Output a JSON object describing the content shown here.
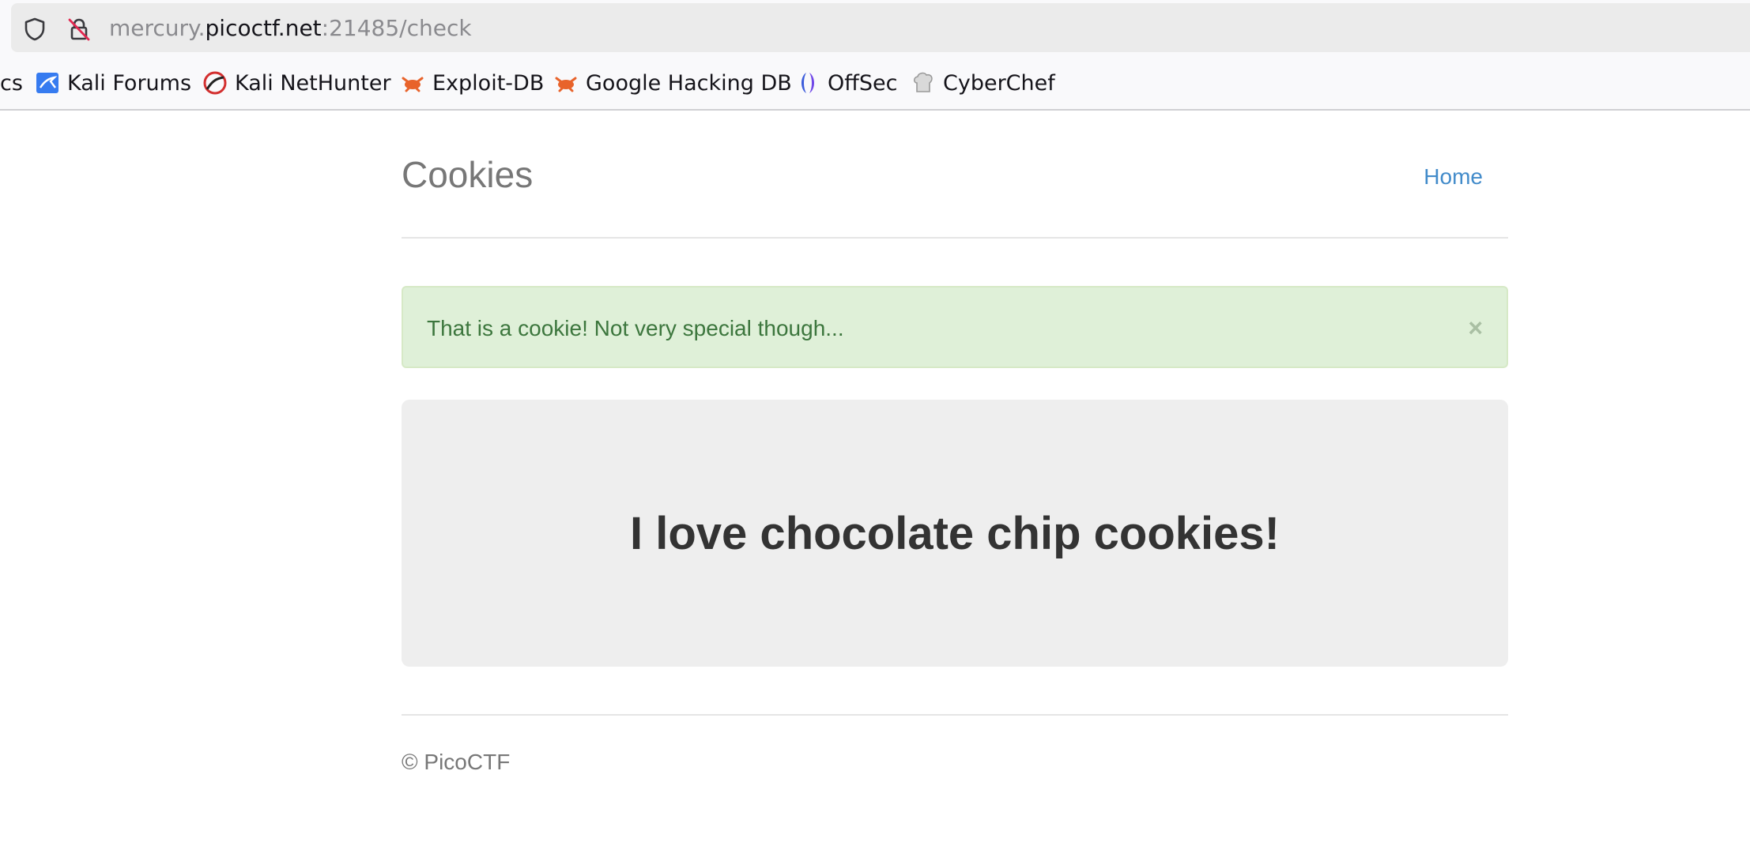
{
  "browser": {
    "url_prefix": "mercury.",
    "url_domain": "picoctf.net",
    "url_suffix": ":21485/check",
    "icons": [
      "shield-icon",
      "insecure-lock-icon"
    ],
    "bookmarks": [
      {
        "label": "cs",
        "icon": ""
      },
      {
        "label": "Kali Forums",
        "icon": "kali-forums-icon"
      },
      {
        "label": "Kali NetHunter",
        "icon": "kali-nethunter-icon"
      },
      {
        "label": "Exploit-DB",
        "icon": "exploit-db-icon"
      },
      {
        "label": "Google Hacking DB",
        "icon": "google-hacking-db-icon"
      },
      {
        "label": "OffSec",
        "icon": "offsec-icon"
      },
      {
        "label": "CyberChef",
        "icon": "cyberchef-icon"
      }
    ]
  },
  "header": {
    "brand": "Cookies",
    "nav_home": "Home"
  },
  "alert": {
    "message": "That is a cookie! Not very special though...",
    "close": "×",
    "color": "#3c763d",
    "background": "#dff0d8"
  },
  "jumbotron": {
    "title": "I love chocolate chip cookies!"
  },
  "footer": {
    "text": "© PicoCTF"
  },
  "colors": {
    "link": "#428bca",
    "brand": "#777777"
  }
}
